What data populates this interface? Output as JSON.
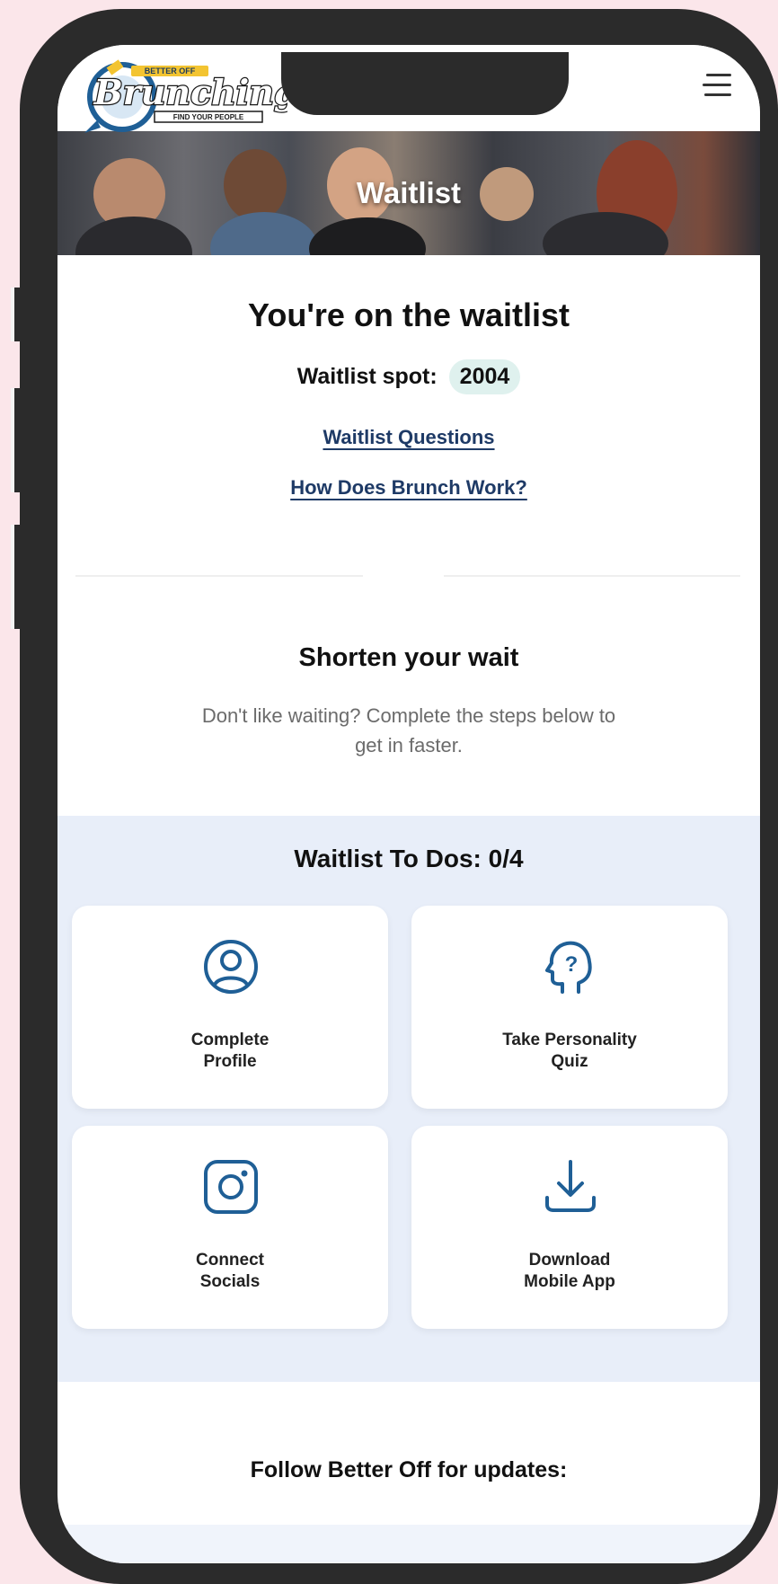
{
  "app": {
    "logo_top": "BETTER OFF",
    "logo_main": "Brunching",
    "logo_tagline": "FIND YOUR PEOPLE"
  },
  "hero": {
    "title": "Waitlist"
  },
  "status": {
    "heading": "You're on the waitlist",
    "spot_label": "Waitlist spot:",
    "spot_value": "2004"
  },
  "links": {
    "questions": "Waitlist Questions",
    "how_it_works": "How Does Brunch Work?"
  },
  "shorten": {
    "heading": "Shorten your wait",
    "line1": "Don't like waiting? Complete the steps below to",
    "line2": "get in faster."
  },
  "todos": {
    "title": "Waitlist To Dos: 0/4",
    "items": [
      {
        "label": "Complete\nProfile",
        "icon": "user-circle-icon"
      },
      {
        "label": "Take Personality\nQuiz",
        "icon": "head-question-icon"
      },
      {
        "label": "Connect\nSocials",
        "icon": "instagram-icon"
      },
      {
        "label": "Download\nMobile App",
        "icon": "download-icon"
      }
    ]
  },
  "footer": {
    "follow": "Follow Better Off for updates:"
  },
  "colors": {
    "accent": "#1f5f96",
    "link": "#1e3a66",
    "todo_bg": "#e8eef9",
    "pill": "#dff1ee"
  }
}
